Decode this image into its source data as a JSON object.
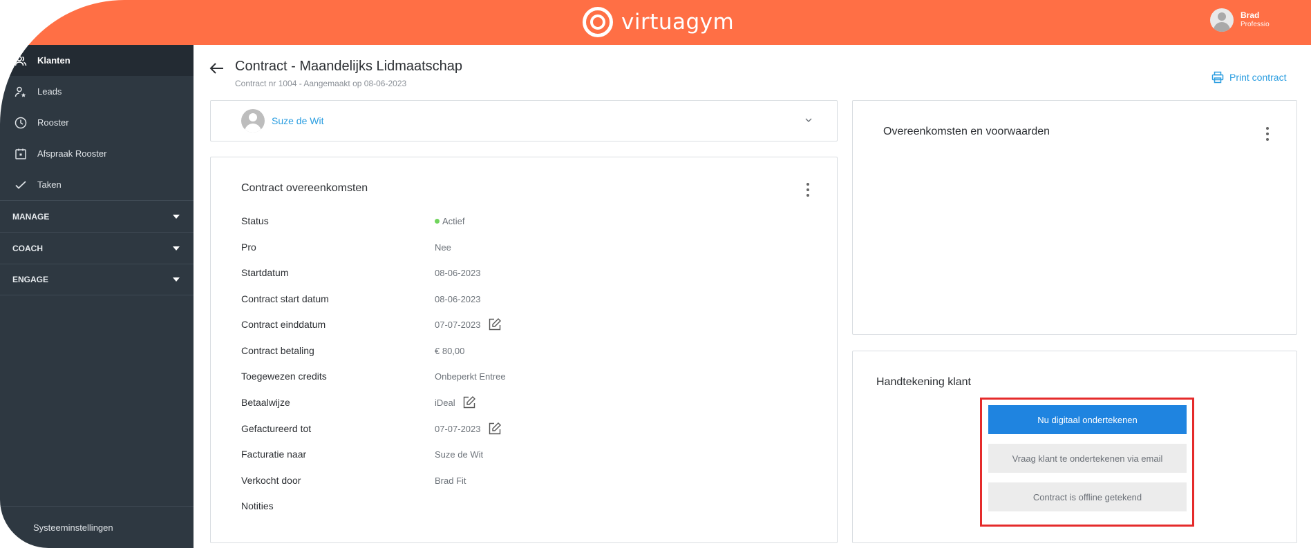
{
  "app": {
    "logo_text": "virtuagym",
    "user_name": "Brad",
    "user_role": "Professio",
    "brand_color": "#ff6f45"
  },
  "sidebar": {
    "items": [
      {
        "label": "Klanten",
        "icon": "users-icon",
        "active": true
      },
      {
        "label": "Leads",
        "icon": "user-star-icon"
      },
      {
        "label": "Rooster",
        "icon": "clock-icon"
      },
      {
        "label": "Afspraak Rooster",
        "icon": "calendar-icon"
      },
      {
        "label": "Taken",
        "icon": "check-icon"
      }
    ],
    "sections": [
      {
        "label": "MANAGE"
      },
      {
        "label": "COACH"
      },
      {
        "label": "ENGAGE"
      }
    ],
    "footer_label": "Systeeminstellingen",
    "bg_color": "#2e3841"
  },
  "page": {
    "title": "Contract - Maandelijks Lidmaatschap",
    "subtitle": "Contract nr 1004 - Aangemaakt op 08-06-2023",
    "print_label": "Print contract"
  },
  "client": {
    "name": "Suze de Wit"
  },
  "contract": {
    "title": "Contract overeenkomsten",
    "fields": [
      {
        "label": "Status",
        "value": "Actief",
        "status_color": "#70d45c"
      },
      {
        "label": "Pro",
        "value": "Nee"
      },
      {
        "label": "Startdatum",
        "value": "08-06-2023"
      },
      {
        "label": "Contract start datum",
        "value": "08-06-2023"
      },
      {
        "label": "Contract einddatum",
        "value": "07-07-2023",
        "editable": true
      },
      {
        "label": "Contract betaling",
        "value": "€ 80,00"
      },
      {
        "label": "Toegewezen credits",
        "value": "Onbeperkt Entree"
      },
      {
        "label": "Betaalwijze",
        "value": "iDeal",
        "editable": true
      },
      {
        "label": "Gefactureerd tot",
        "value": "07-07-2023",
        "editable": true
      },
      {
        "label": "Facturatie naar",
        "value": "Suze de Wit"
      },
      {
        "label": "Verkocht door",
        "value": "Brad Fit"
      },
      {
        "label": "Notities",
        "value": ""
      }
    ]
  },
  "terms": {
    "title": "Overeenkomsten en voorwaarden"
  },
  "signature": {
    "title": "Handtekening klant",
    "sign_now_label": "Nu digitaal ondertekenen",
    "email_label": "Vraag klant te ondertekenen via email",
    "offline_label": "Contract is offline getekend",
    "primary_color": "#1f84e0",
    "highlight_color": "#e52b2b"
  }
}
